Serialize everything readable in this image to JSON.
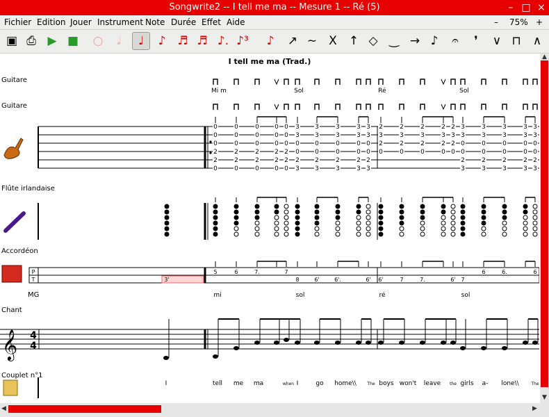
{
  "window": {
    "title": "Songwrite2 -- I tell me ma -- Mesure 1 -- Ré (5)",
    "min": "–",
    "max": "□",
    "close": "×"
  },
  "menu": {
    "items": [
      "Fichier",
      "Edition",
      "Jouer",
      "Instrument",
      "Note",
      "Durée",
      "Effet",
      "Aide"
    ],
    "zoom_out": "–",
    "zoom": "75%",
    "zoom_in": "+"
  },
  "toolbar": {
    "buttons": [
      {
        "name": "save-icon",
        "glyph": "▣"
      },
      {
        "name": "preview-icon",
        "glyph": "⎙"
      },
      {
        "name": "play-icon",
        "glyph": "▶"
      },
      {
        "name": "stop-icon",
        "glyph": "■"
      },
      {
        "name": "whole-note-icon",
        "glyph": "○"
      },
      {
        "name": "half-note-icon",
        "glyph": "𝅗𝅥"
      },
      {
        "name": "quarter-note-icon",
        "glyph": "♩"
      },
      {
        "name": "eighth-note-icon",
        "glyph": "♪"
      },
      {
        "name": "sixteenth-note-icon",
        "glyph": "♬"
      },
      {
        "name": "thirtysecond-note-icon",
        "glyph": "♬"
      },
      {
        "name": "dotted-note-icon",
        "glyph": "♪."
      },
      {
        "name": "triplet-note-icon",
        "glyph": "♪³"
      },
      {
        "name": "note-color-icon",
        "glyph": "♪"
      },
      {
        "name": "slide-icon",
        "glyph": "↗"
      },
      {
        "name": "bend-icon",
        "glyph": "∼"
      },
      {
        "name": "dead-note-icon",
        "glyph": "X"
      },
      {
        "name": "up-stroke-icon",
        "glyph": "↑"
      },
      {
        "name": "harmonic-icon",
        "glyph": "◇"
      },
      {
        "name": "legato-icon",
        "glyph": "‿"
      },
      {
        "name": "link-icon",
        "glyph": "→"
      },
      {
        "name": "appoggiatura-icon",
        "glyph": "♪"
      },
      {
        "name": "fermata-icon",
        "glyph": "𝄐"
      },
      {
        "name": "breath-icon",
        "glyph": "❜"
      },
      {
        "name": "down-bow-icon",
        "glyph": "∨"
      },
      {
        "name": "up-bow-icon",
        "glyph": "⊓"
      },
      {
        "name": "accent-icon",
        "glyph": "∧"
      }
    ]
  },
  "score": {
    "title": "I tell me ma (Trad.)",
    "tracks": {
      "guitar1": "Guitare",
      "guitar2": "Guitare",
      "flute": "Flûte irlandaise",
      "accordion": "Accordéon",
      "accordion_mg": "MG",
      "accordion_p": "P",
      "accordion_t": "T",
      "chant": "Chant",
      "couplet": "Couplet n°1"
    },
    "chords": [
      "Mi m",
      "Sol",
      "Ré",
      "Sol"
    ],
    "accordion_top": [
      "5",
      "6",
      "7.",
      "7",
      "6",
      "6.",
      "6"
    ],
    "accordion_bottom": [
      "3'",
      "8",
      "6'",
      "6'.",
      "6'",
      "6'",
      "7",
      "7.",
      "6'",
      "7"
    ],
    "accordion_mg": [
      "mi",
      "sol",
      "ré",
      "sol"
    ],
    "lyrics": [
      "I",
      "tell",
      "me",
      "ma",
      "when",
      "I",
      "go",
      "home\\\\",
      "The",
      "boys",
      "won't",
      "leave",
      "the",
      "girls",
      "a-",
      "lone\\\\",
      "The"
    ],
    "tab_strings": [
      [
        "0",
        "0",
        "0",
        "0",
        "0",
        "3",
        "3",
        "3",
        "3",
        "3",
        "2",
        "2",
        "2",
        "2",
        "2",
        "3",
        "3",
        "3",
        "3",
        "3"
      ],
      [
        "0",
        "0",
        "0",
        "0",
        "0",
        "3",
        "3",
        "3",
        "3",
        "3",
        "3",
        "3",
        "3",
        "3",
        "3",
        "3",
        "3",
        "3",
        "3",
        "3"
      ],
      [
        "0",
        "0",
        "0",
        "0",
        "0",
        "0",
        "0",
        "0",
        "0",
        "0",
        "2",
        "2",
        "2",
        "2",
        "2",
        "0",
        "0",
        "0",
        "0",
        "0"
      ],
      [
        "2",
        "2",
        "2",
        "2",
        "2",
        "0",
        "0",
        "0",
        "0",
        "0",
        "0",
        "0",
        "0",
        "0",
        "0",
        "0",
        "0",
        "0",
        "0",
        "0"
      ],
      [
        "2",
        "2",
        "2",
        "2",
        "2",
        "2",
        "2",
        "2",
        "2",
        "2",
        "",
        "",
        "",
        "",
        "",
        "2",
        "2",
        "2",
        "2",
        "2"
      ],
      [
        "0",
        "0",
        "0",
        "0",
        "0",
        "3",
        "3",
        "3",
        "3",
        "3",
        "",
        "",
        "",
        "",
        "",
        "3",
        "3",
        "3",
        "3",
        "3"
      ]
    ],
    "time_signature": "4/4"
  }
}
